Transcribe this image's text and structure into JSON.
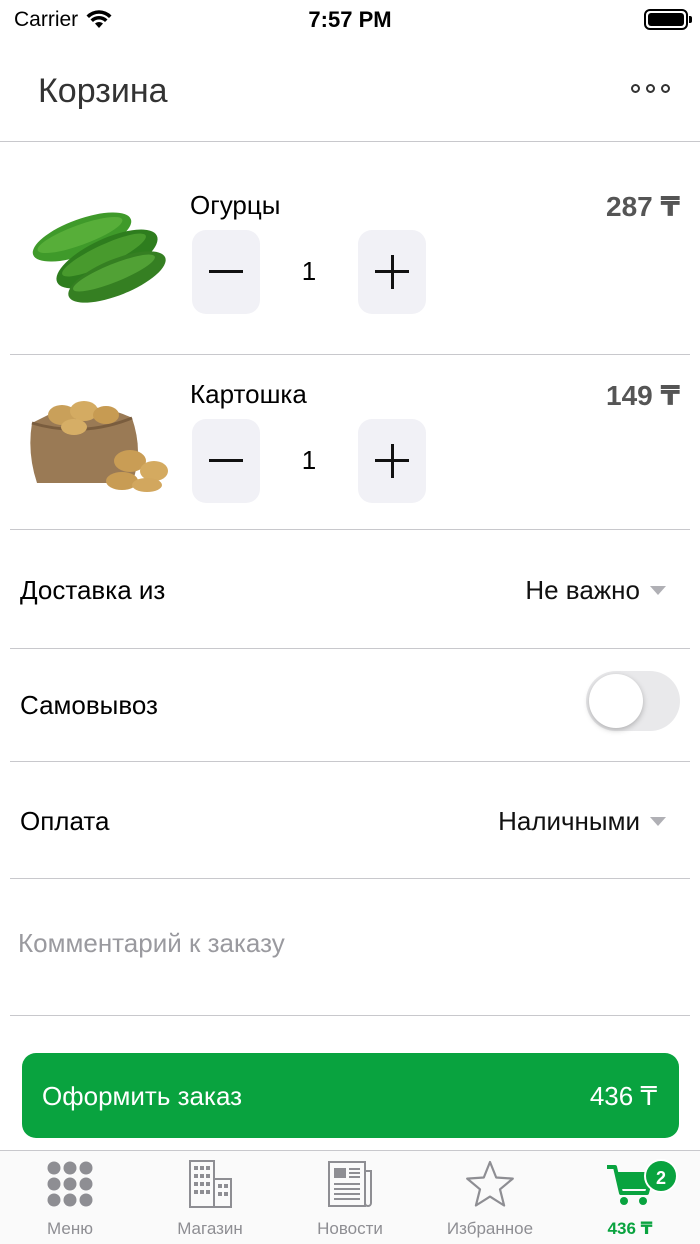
{
  "status_bar": {
    "carrier": "Carrier",
    "time": "7:57 PM"
  },
  "header": {
    "title": "Корзина"
  },
  "cart": {
    "items": [
      {
        "name": "Огурцы",
        "price": "287 ₸",
        "quantity": "1",
        "image": "cucumbers-image"
      },
      {
        "name": "Картошка",
        "price": "149 ₸",
        "quantity": "1",
        "image": "potatoes-image"
      }
    ]
  },
  "options": {
    "delivery": {
      "label": "Доставка из",
      "value": "Не важно"
    },
    "pickup": {
      "label": "Самовывоз",
      "enabled": false
    },
    "payment": {
      "label": "Оплата",
      "value": "Наличными"
    },
    "comment": {
      "placeholder": "Комментарий к заказу",
      "value": ""
    }
  },
  "checkout": {
    "label": "Оформить заказ",
    "total": "436 ₸"
  },
  "tab_bar": {
    "tabs": [
      {
        "label": "Меню",
        "icon": "grid-icon"
      },
      {
        "label": "Магазин",
        "icon": "building-icon"
      },
      {
        "label": "Новости",
        "icon": "newspaper-icon"
      },
      {
        "label": "Избранное",
        "icon": "star-icon"
      },
      {
        "label": "436 ₸",
        "icon": "cart-icon",
        "badge": "2",
        "active": true
      }
    ]
  },
  "colors": {
    "accent": "#09a33f",
    "separator": "#c8c8cc",
    "stepper_bg": "#f1f1f6",
    "inactive_tab": "#8e8e93"
  }
}
